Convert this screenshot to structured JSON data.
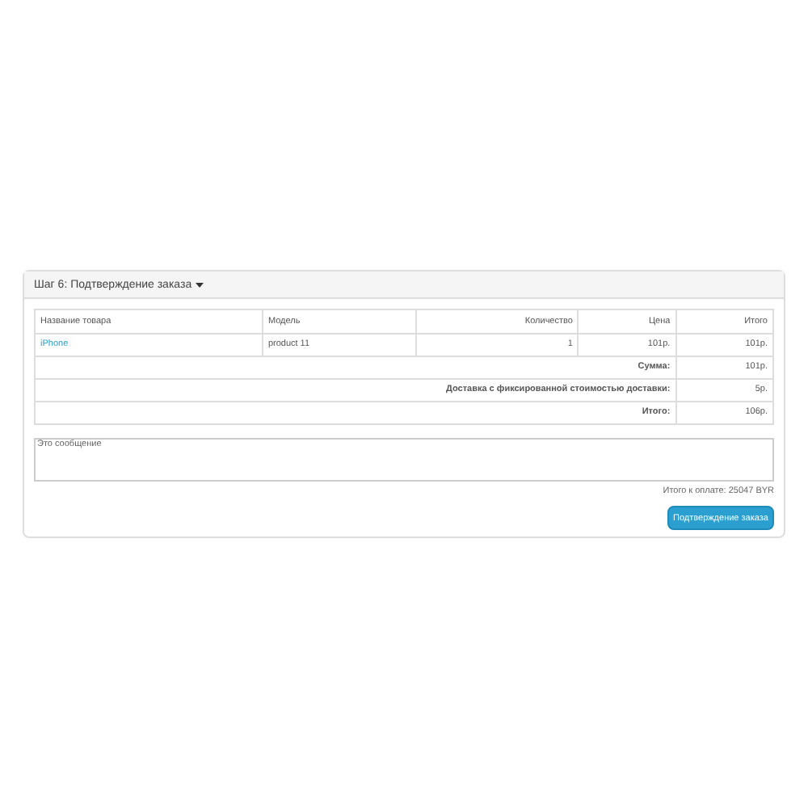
{
  "panel": {
    "title": "Шаг 6: Подтверждение заказа"
  },
  "table": {
    "columns": [
      "Название товара",
      "Модель",
      "Количество",
      "Цена",
      "Итого"
    ],
    "rows": [
      {
        "name": "iPhone",
        "model": "product 11",
        "quantity": "1",
        "price": "101р.",
        "total": "101р."
      }
    ],
    "totals": [
      {
        "label": "Сумма:",
        "value": "101р."
      },
      {
        "label": "Доставка с фиксированной стоимостью доставки:",
        "value": "5р."
      },
      {
        "label": "Итого:",
        "value": "106р."
      }
    ]
  },
  "comment": {
    "value": "Это сообщение"
  },
  "payment_total": "Итого к оплате: 25047 BYR",
  "confirm_button": "Подтверждение заказа"
}
